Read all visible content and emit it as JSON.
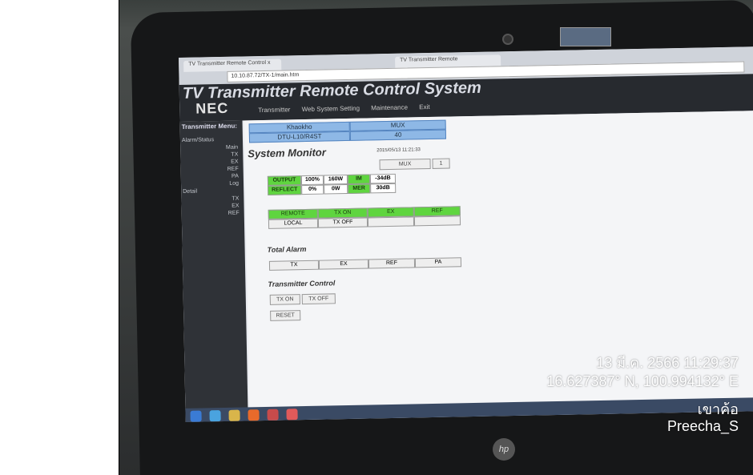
{
  "browser": {
    "tab_active": "TV Transmitter Remote Control x",
    "tab_other": "TV Transmitter Remote",
    "url": "10.10.87.72/TX-1/main.htm"
  },
  "app": {
    "title": "TV Transmitter Remote Control System",
    "brand": "NEC",
    "menu": [
      "Transmitter",
      "Web System Setting",
      "Maintenance",
      "Exit"
    ]
  },
  "sidebar": {
    "heading": "Transmitter Menu:",
    "alarm_status": "Alarm/Status",
    "alarm_items": [
      "Main",
      "TX",
      "EX",
      "REF",
      "PA",
      "Log"
    ],
    "detail": "Detail",
    "detail_items": [
      "TX",
      "EX",
      "REF"
    ]
  },
  "device": {
    "site": "Khaokho",
    "mode": "MUX",
    "model": "DTU-L10/R4ST",
    "channel": "40"
  },
  "monitor": {
    "title": "System Monitor",
    "timestamp": "2015/05/13 11:21:33",
    "mux_label": "MUX",
    "mux_value": "1",
    "output_label": "OUTPUT",
    "output_pct": "100%",
    "output_power": "160W",
    "im_label": "IM",
    "im_value": "-34dB",
    "reflect_label": "REFLECT",
    "reflect_pct": "0%",
    "reflect_power": "0W",
    "mer_label": "MER",
    "mer_value": "30dB"
  },
  "status": {
    "remote": "REMOTE",
    "tx_on": "TX ON",
    "ex": "EX",
    "ref": "REF",
    "local": "LOCAL",
    "tx_off": "TX OFF"
  },
  "alarm": {
    "title": "Total Alarm",
    "items": [
      "TX",
      "EX",
      "REF",
      "PA"
    ]
  },
  "control": {
    "title": "Transmitter Control",
    "tx_on": "TX ON",
    "tx_off": "TX OFF",
    "reset": "RESET"
  },
  "photo_stamp": {
    "datetime": "13 มี.ค. 2566 11:29:37",
    "coords": "16.627387° N, 100.994132° E",
    "place": "เขาค้อ",
    "user": "Preecha_S"
  },
  "colors": {
    "green": "#5fd53f",
    "blue": "#8eb8e6",
    "header": "#272a2f"
  }
}
